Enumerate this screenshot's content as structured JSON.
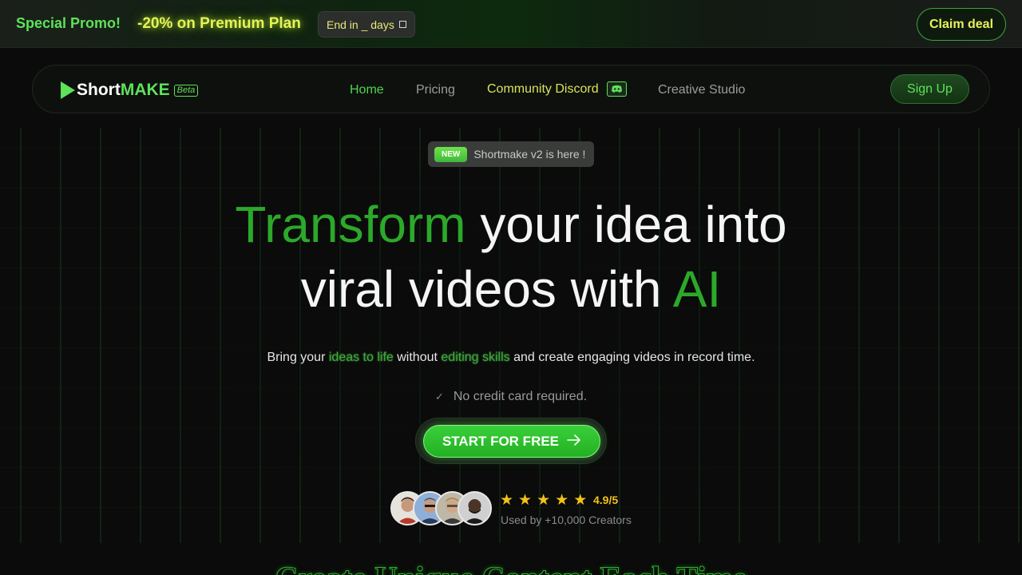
{
  "promo": {
    "title": "Special Promo!",
    "offer": "-20% on Premium Plan",
    "timer": "End in _ days",
    "claim_label": "Claim deal"
  },
  "nav": {
    "logo_short": "Short",
    "logo_make": "MAKE",
    "logo_beta": "Beta",
    "links": {
      "home": "Home",
      "pricing": "Pricing",
      "discord": "Community Discord",
      "studio": "Creative Studio"
    },
    "signup_label": "Sign Up"
  },
  "hero": {
    "new_tag": "NEW",
    "new_text": "Shortmake v2 is here !",
    "headline": {
      "line1_accent": "Transform",
      "line1_rest": " your idea into",
      "line2_start": "viral videos with ",
      "line2_accent": "AI"
    },
    "subtitle": {
      "p1": "Bring your ",
      "hl1": "ideas to life",
      "p2": " without ",
      "hl2": "editing skills",
      "p3": " and create engaging videos in record time."
    },
    "no_cc": "No credit card required.",
    "cta_label": "START FOR FREE",
    "rating": "4.9/5",
    "used_by": "Used by +10,000 Creators"
  },
  "next_section_title": "Create Unique Content Each Time",
  "colors": {
    "accent": "#5ee25a",
    "accent_dark": "#2ca82a",
    "yellow": "#e8f25a",
    "star": "#f2c21a",
    "background": "#0a0b0a"
  }
}
